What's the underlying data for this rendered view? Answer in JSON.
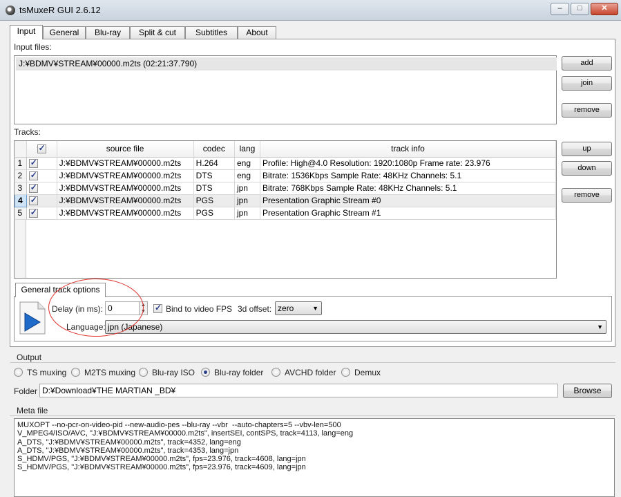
{
  "window": {
    "title": "tsMuxeR GUI 2.6.12",
    "minimize": "–",
    "maximize": "□",
    "close": "✕"
  },
  "tabs": [
    "Input",
    "General",
    "Blu-ray",
    "Split & cut",
    "Subtitles",
    "About"
  ],
  "input_files": {
    "label": "Input files:",
    "files": [
      "J:¥BDMV¥STREAM¥00000.m2ts (02:21:37.790)"
    ],
    "add": "add",
    "join": "join",
    "remove": "remove"
  },
  "tracks": {
    "label": "Tracks:",
    "columns": [
      "source file",
      "codec",
      "lang",
      "track info"
    ],
    "rows": [
      {
        "num": "1",
        "source": "J:¥BDMV¥STREAM¥00000.m2ts",
        "codec": "H.264",
        "lang": "eng",
        "info": "Profile: High@4.0  Resolution: 1920:1080p  Frame rate: 23.976"
      },
      {
        "num": "2",
        "source": "J:¥BDMV¥STREAM¥00000.m2ts",
        "codec": "DTS",
        "lang": "eng",
        "info": "Bitrate: 1536Kbps  Sample Rate: 48KHz  Channels: 5.1"
      },
      {
        "num": "3",
        "source": "J:¥BDMV¥STREAM¥00000.m2ts",
        "codec": "DTS",
        "lang": "jpn",
        "info": "Bitrate: 768Kbps  Sample Rate: 48KHz  Channels: 5.1"
      },
      {
        "num": "4",
        "source": "J:¥BDMV¥STREAM¥00000.m2ts",
        "codec": "PGS",
        "lang": "jpn",
        "info": "Presentation Graphic Stream #0"
      },
      {
        "num": "5",
        "source": "J:¥BDMV¥STREAM¥00000.m2ts",
        "codec": "PGS",
        "lang": "jpn",
        "info": "Presentation Graphic Stream #1"
      }
    ],
    "up": "up",
    "down": "down",
    "remove": "remove"
  },
  "track_options": {
    "tab_label": "General track options",
    "delay_label": "Delay (in ms):",
    "delay_value": "0",
    "bind_label": "Bind to video FPS",
    "offset_label": "3d offset:",
    "offset_value": "zero",
    "language_label": "Language:",
    "language_value": "jpn (Japanese)"
  },
  "output": {
    "label": "Output",
    "options": [
      "TS muxing",
      "M2TS muxing",
      "Blu-ray ISO",
      "Blu-ray folder",
      "AVCHD folder",
      "Demux"
    ],
    "selected": "Blu-ray folder",
    "folder_label": "Folder",
    "folder_value": "D:¥Download¥THE MARTIAN _BD¥",
    "browse": "Browse"
  },
  "meta": {
    "label": "Meta file",
    "lines": [
      "MUXOPT --no-pcr-on-video-pid --new-audio-pes --blu-ray --vbr  --auto-chapters=5 --vbv-len=500",
      "V_MPEG4/ISO/AVC, \"J:¥BDMV¥STREAM¥00000.m2ts\", insertSEI, contSPS, track=4113, lang=eng",
      "A_DTS, \"J:¥BDMV¥STREAM¥00000.m2ts\", track=4352, lang=eng",
      "A_DTS, \"J:¥BDMV¥STREAM¥00000.m2ts\", track=4353, lang=jpn",
      "S_HDMV/PGS, \"J:¥BDMV¥STREAM¥00000.m2ts\", fps=23.976, track=4608, lang=jpn",
      "S_HDMV/PGS, \"J:¥BDMV¥STREAM¥00000.m2ts\", fps=23.976, track=4609, lang=jpn"
    ]
  }
}
